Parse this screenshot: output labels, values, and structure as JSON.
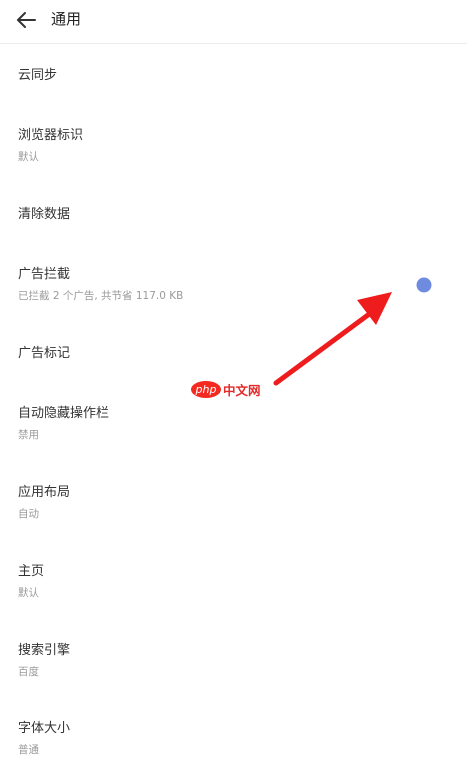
{
  "header": {
    "title": "通用",
    "back_icon": "arrow-left-icon"
  },
  "settings": [
    {
      "label": "云同步",
      "sub": ""
    },
    {
      "label": "浏览器标识",
      "sub": "默认"
    },
    {
      "label": "清除数据",
      "sub": ""
    },
    {
      "label": "广告拦截",
      "sub": "已拦截 2 个广告, 共节省 117.0 KB"
    },
    {
      "label": "广告标记",
      "sub": ""
    },
    {
      "label": "自动隐藏操作栏",
      "sub": "禁用"
    },
    {
      "label": "应用布局",
      "sub": "自动"
    },
    {
      "label": "主页",
      "sub": "默认"
    },
    {
      "label": "搜索引擎",
      "sub": "百度"
    },
    {
      "label": "字体大小",
      "sub": "普通"
    }
  ],
  "annotation": {
    "arrow_color": "#ee1c1c",
    "dot_color": "#6f8be0"
  },
  "watermark": {
    "badge": "php",
    "text": "中文网"
  }
}
